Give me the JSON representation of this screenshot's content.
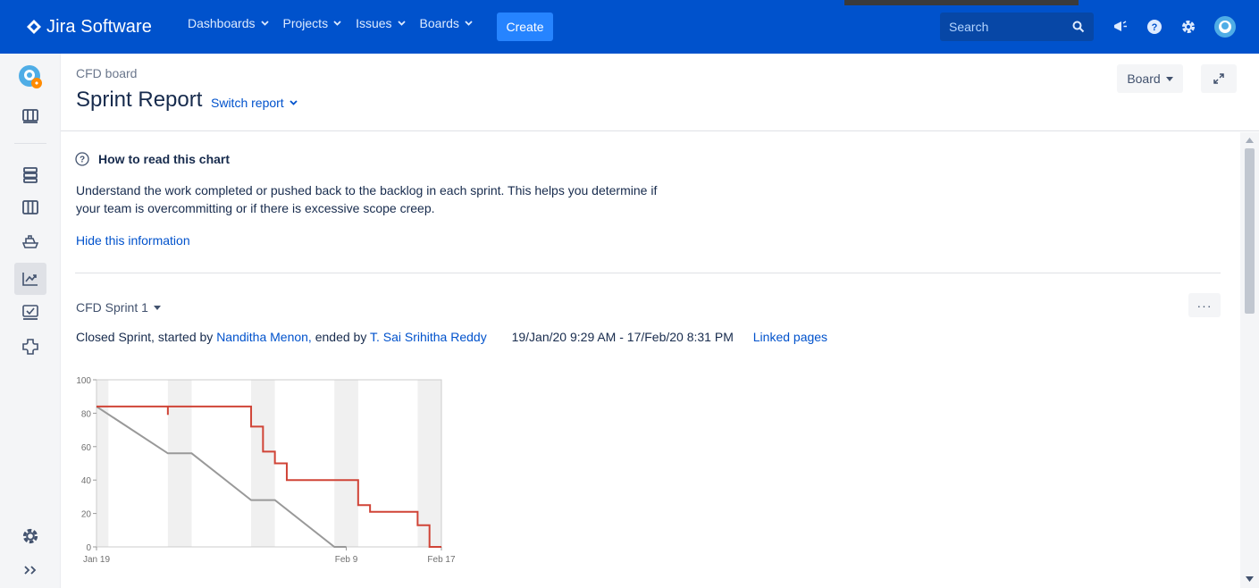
{
  "topbar": {
    "app_name": "Jira Software",
    "nav": [
      {
        "label": "Dashboards"
      },
      {
        "label": "Projects"
      },
      {
        "label": "Issues"
      },
      {
        "label": "Boards"
      }
    ],
    "create_label": "Create",
    "search_placeholder": "Search",
    "icons": [
      "notifications-icon",
      "help-icon",
      "settings-icon",
      "user-avatar"
    ],
    "colors": {
      "bar": "#0052cc",
      "create": "#2684ff",
      "search": "#0747a6"
    }
  },
  "sidebar": {
    "items": [
      "project-avatar",
      "board-icon",
      "backlog-icon",
      "active-sprint-icon",
      "releases-icon",
      "reports-icon",
      "issues-icon",
      "components-icon",
      "project-settings-icon",
      "collapse-icon"
    ],
    "active": "reports-icon"
  },
  "header": {
    "breadcrumb": "CFD board",
    "title": "Sprint Report",
    "switch_report": "Switch report",
    "board_button": "Board"
  },
  "info": {
    "heading": "How to read this chart",
    "text_line1": "Understand the work completed or pushed back to the backlog in each sprint. This helps you determine if",
    "text_line2": "your team is overcommitting or if there is excessive scope creep.",
    "hide_link": "Hide this information"
  },
  "sprint": {
    "name": "CFD Sprint 1",
    "more_label": "···",
    "status_prefix": "Closed Sprint, started by",
    "started_by": "Nanditha Menon,",
    "ended_prefix": "ended by",
    "ended_by": "T. Sai Srihitha Reddy",
    "dates": "19/Jan/20 9:29 AM - 17/Feb/20 8:31 PM",
    "linked_pages": "Linked pages"
  },
  "chart_data": {
    "type": "line",
    "xlabel": "",
    "ylabel": "",
    "ylim": [
      0,
      100
    ],
    "xlim_days": "2020-01-19 to 2020-02-17",
    "y_ticks": [
      "0",
      "20",
      "40",
      "60",
      "80",
      "100"
    ],
    "x_ticks": [
      {
        "label": "Jan 19",
        "date": "2020-01-19"
      },
      {
        "label": "Feb 9",
        "date": "2020-02-09"
      },
      {
        "label": "Feb 17",
        "date": "2020-02-17"
      }
    ],
    "weekends": [
      [
        "2020-01-19",
        "2020-01-19"
      ],
      [
        "2020-01-25",
        "2020-01-26"
      ],
      [
        "2020-02-01",
        "2020-02-02"
      ],
      [
        "2020-02-08",
        "2020-02-09"
      ],
      [
        "2020-02-15",
        "2020-02-16"
      ]
    ],
    "series": [
      {
        "name": "",
        "color": "#999999",
        "points": [
          [
            "2020-01-19",
            84
          ],
          [
            "2020-01-25",
            56
          ],
          [
            "2020-01-27",
            56
          ],
          [
            "2020-02-01",
            28
          ],
          [
            "2020-02-03",
            28
          ],
          [
            "2020-02-08",
            0
          ],
          [
            "2020-02-09",
            0
          ]
        ]
      },
      {
        "name": "",
        "color": "#d04437",
        "step": true,
        "points": [
          [
            "2020-01-19",
            84
          ],
          [
            "2020-01-25",
            84
          ],
          [
            "2020-01-25",
            79
          ],
          [
            "2020-01-25",
            84
          ],
          [
            "2020-02-01",
            84
          ],
          [
            "2020-02-01",
            72
          ],
          [
            "2020-02-02",
            67
          ],
          [
            "2020-02-02",
            57
          ],
          [
            "2020-02-03",
            50
          ],
          [
            "2020-02-04",
            40
          ],
          [
            "2020-02-10",
            40
          ],
          [
            "2020-02-10",
            25
          ],
          [
            "2020-02-11",
            21
          ],
          [
            "2020-02-15",
            21
          ],
          [
            "2020-02-15",
            13
          ],
          [
            "2020-02-16",
            0
          ],
          [
            "2020-02-17",
            0
          ]
        ]
      }
    ]
  }
}
